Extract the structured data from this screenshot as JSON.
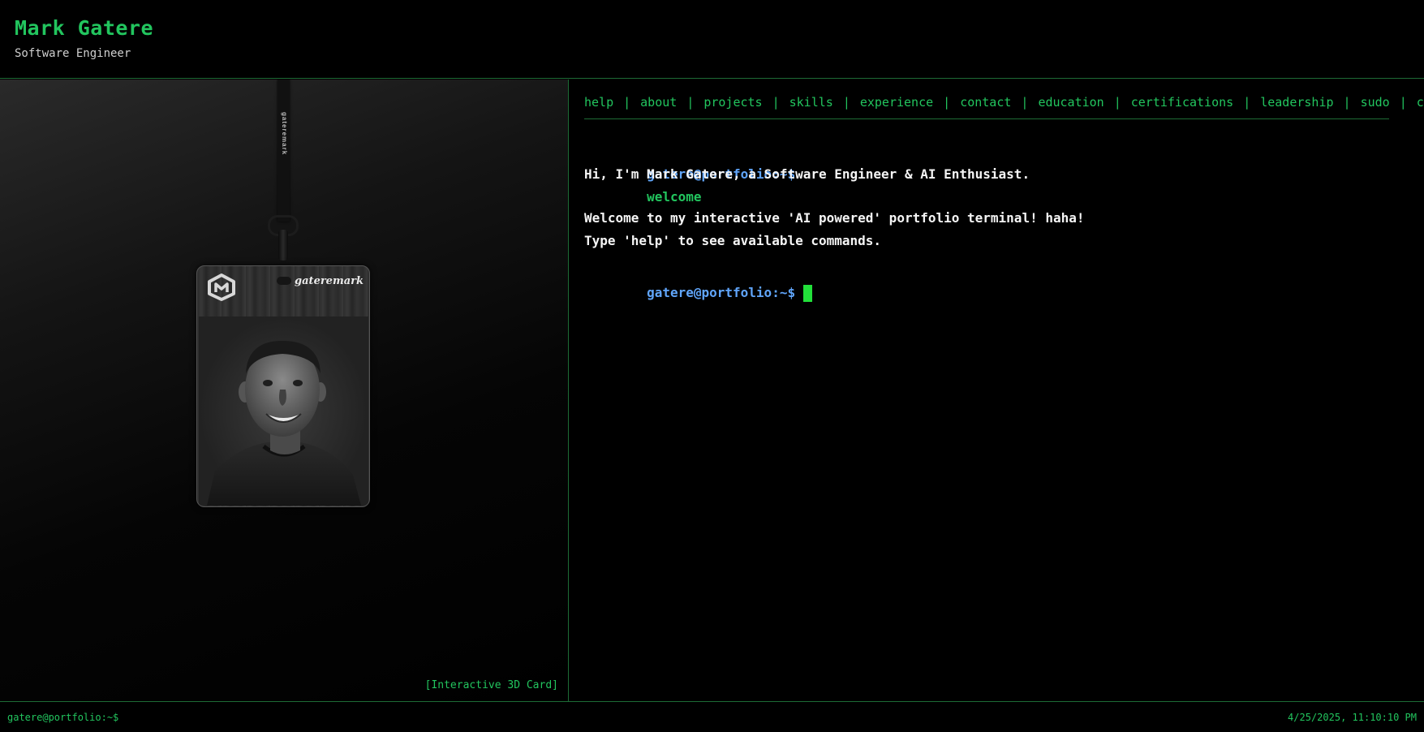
{
  "header": {
    "title": "Mark Gatere",
    "subtitle": "Software Engineer"
  },
  "badge": {
    "brand": "gateremark",
    "strap_text": "gateremark",
    "logo_icon": "gm-monogram-icon",
    "photo": "portrait-photo"
  },
  "left_panel": {
    "caption": "[Interactive 3D Card]"
  },
  "terminal": {
    "nav": [
      {
        "label": "help"
      },
      {
        "label": "about"
      },
      {
        "label": "projects"
      },
      {
        "label": "skills"
      },
      {
        "label": "experience"
      },
      {
        "label": "contact"
      },
      {
        "label": "education"
      },
      {
        "label": "certifications"
      },
      {
        "label": "leadership"
      },
      {
        "label": "sudo"
      },
      {
        "label": "clear"
      }
    ],
    "separator": "|",
    "prompt": "gatere@portfolio:~$",
    "last_command": "welcome",
    "output": [
      "Hi, I'm Mark Gatere, a Software Engineer & AI Enthusiast.",
      "Welcome to my interactive 'AI powered' portfolio terminal! haha!",
      "Type 'help' to see available commands."
    ]
  },
  "footer": {
    "prompt": "gatere@portfolio:~$",
    "datetime": "4/25/2025, 11:10:10 PM"
  },
  "colors": {
    "accent_green": "#22c55e",
    "prompt_blue": "#60a5fa",
    "cursor_green": "#22e03a",
    "border_green": "#1d6b35",
    "background": "#000000"
  }
}
